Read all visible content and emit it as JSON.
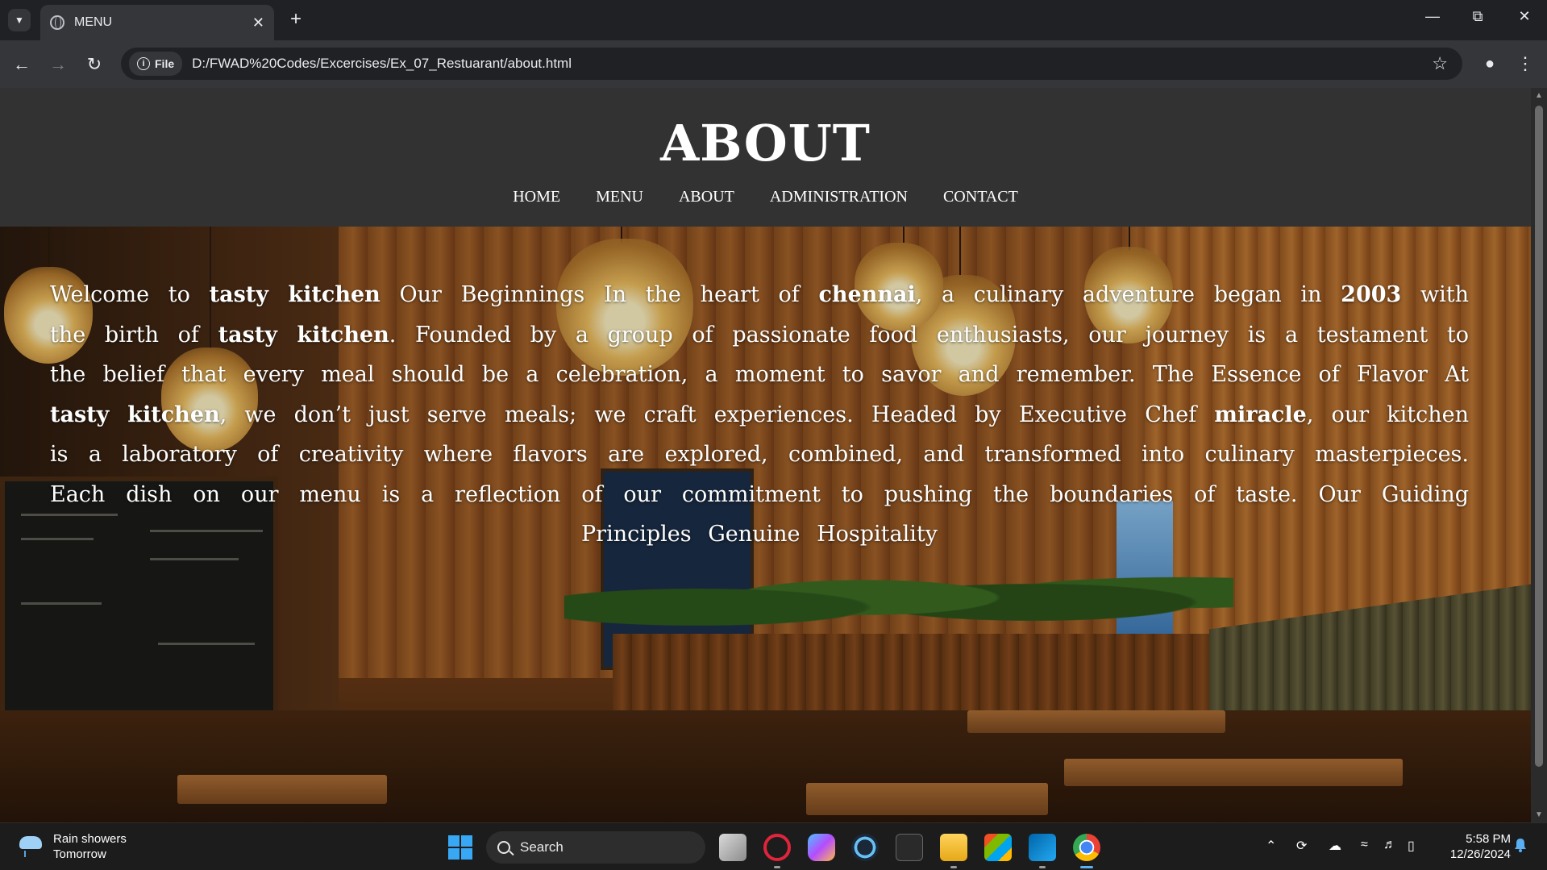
{
  "browser": {
    "tab_title": "MENU",
    "address_chip": "File",
    "url": "D:/FWAD%20Codes/Excercises/Ex_07_Restuarant/about.html"
  },
  "page": {
    "site_title": "ABOUT",
    "nav": [
      "HOME",
      "MENU",
      "ABOUT",
      "ADMINISTRATION",
      "CONTACT"
    ],
    "about": {
      "t1": "Welcome to ",
      "b1": "tasty kitchen",
      "t2": " Our Beginnings In the heart of ",
      "b2": "chennai",
      "t3": ", a culinary adventure began in ",
      "b3": "2003",
      "t4": " with the birth of ",
      "b4": "tasty kitchen",
      "t5": ". Founded by a group of passionate food enthusiasts, our journey is a testament to the belief that every meal should be a celebration, a moment to savor and remember. The Essence of Flavor At ",
      "b5": "tasty kitchen",
      "t6": ", we don’t just serve meals; we craft experiences. Headed by Executive Chef ",
      "b6": "miracle",
      "t7": ", our kitchen is a laboratory of creativity where flavors are explored, combined, and transformed into culinary masterpieces. Each dish on our menu is a reflection of our commitment to pushing the boundaries of taste. Our Guiding Principles Genuine Hospitality"
    }
  },
  "taskbar": {
    "weather_line1": "Rain showers",
    "weather_line2": "Tomorrow",
    "search_placeholder": "Search",
    "time": "5:58 PM",
    "date": "12/26/2024"
  },
  "colors": {
    "header_bg": "#323232",
    "text": "#ffffff",
    "browser_bg": "#202124",
    "toolbar_bg": "#35363a",
    "taskbar_bg": "#1c1c1c"
  }
}
